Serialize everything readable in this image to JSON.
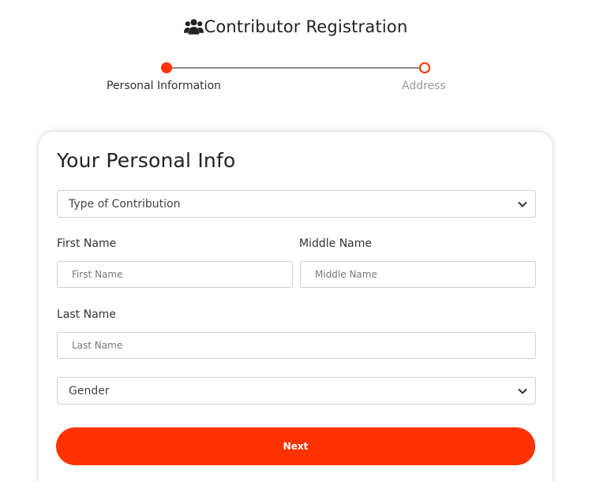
{
  "header": {
    "title": "Contributor Registration",
    "icon": "users-icon"
  },
  "steps": [
    {
      "label": "Personal Information",
      "state": "active"
    },
    {
      "label": "Address",
      "state": "inactive"
    }
  ],
  "form": {
    "heading": "Your Personal Info",
    "contribution_type": {
      "selected": "Type of Contribution"
    },
    "first_name": {
      "label": "First Name",
      "placeholder": "First Name",
      "value": ""
    },
    "middle_name": {
      "label": "Middle Name",
      "placeholder": "Middle Name",
      "value": ""
    },
    "last_name": {
      "label": "Last Name",
      "placeholder": "Last Name",
      "value": ""
    },
    "gender": {
      "selected": "Gender"
    },
    "next_label": "Next"
  },
  "colors": {
    "accent": "#ff3300",
    "progress_line": "#888888",
    "inactive_text": "#9a9a9a"
  }
}
